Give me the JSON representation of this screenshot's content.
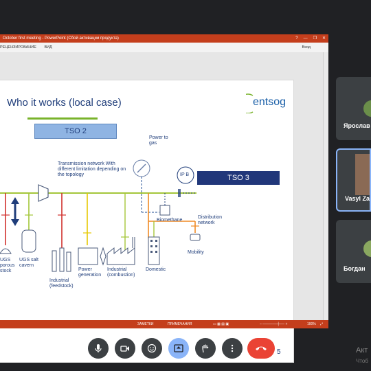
{
  "ppt": {
    "title": "October first meeting  -  PowerPoint (Сбой активации продукта)",
    "window_controls": [
      "?",
      "—",
      "❐",
      "✕"
    ],
    "menu": [
      "РЕЦЕНЗИРОВАНИЕ",
      "ВИД"
    ],
    "menu_right": "Вход",
    "status": {
      "notes": "ЗАМЕТКИ",
      "comments": "ПРИМЕЧАНИЯ",
      "zoom": "100%"
    }
  },
  "slide": {
    "title": "Who it works (local case)",
    "logo": "entsog",
    "tso2": "TSO 2",
    "tso3": "TSO 3",
    "power_to_gas": "Power to gas",
    "transmission_network": "Transmission network With different limitation depending on the topology",
    "ip_b": "IP B",
    "biomethane": "Biomethane",
    "distribution_network": "Distribution network",
    "mobility": "Mobility",
    "ugs_porous": "UGS porous stock",
    "ugs_salt": "UGS salt cavern",
    "industrial_feedstock": "Industrial (feedstock)",
    "power_generation": "Power generation",
    "industrial_combustion": "Industrial (combustion)",
    "domestic": "Domestic",
    "page_number": "5"
  },
  "participants": [
    {
      "name": "Ярослав"
    },
    {
      "name": "Vasyl Za"
    },
    {
      "name": "Богдан"
    }
  ],
  "controls": [
    "microphone",
    "camera",
    "emoji",
    "present",
    "raise-hand",
    "more",
    "end-call"
  ],
  "watermark": {
    "line1": "Акт",
    "line2": "Чтоб"
  },
  "colors": {
    "ppt_red": "#c43e1c",
    "meet_bg": "#202124",
    "tile_bg": "#3c4043",
    "end_call": "#ea4335",
    "present_active": "#8ab4f8",
    "line_green": "#a4c639",
    "line_red": "#d0312d",
    "line_yellow": "#e6c800",
    "line_orange": "#f08a24"
  }
}
